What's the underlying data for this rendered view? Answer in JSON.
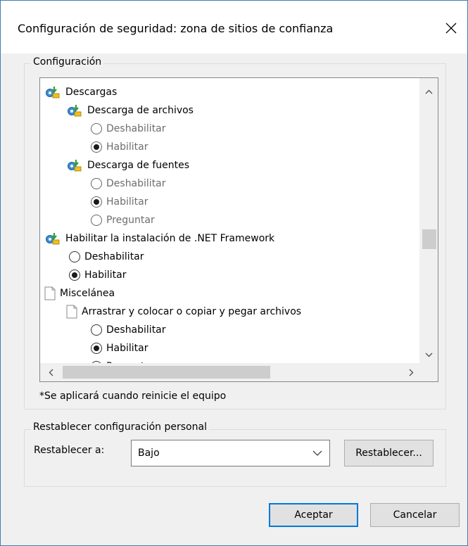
{
  "window": {
    "title": "Configuración de seguridad: zona de sitios de confianza",
    "close_glyph": "✕"
  },
  "settings_group": {
    "legend": "Configuración",
    "items": [
      {
        "kind": "gear",
        "level": 0,
        "label": "Descargas"
      },
      {
        "kind": "gear",
        "level": 1,
        "label": "Descarga de archivos"
      },
      {
        "kind": "radio",
        "level": 2,
        "label": "Deshabilitar",
        "checked": false,
        "dim": true
      },
      {
        "kind": "radio",
        "level": 2,
        "label": "Habilitar",
        "checked": true,
        "dim": true
      },
      {
        "kind": "gear",
        "level": 1,
        "label": "Descarga de fuentes"
      },
      {
        "kind": "radio",
        "level": 2,
        "label": "Deshabilitar",
        "checked": false,
        "dim": true
      },
      {
        "kind": "radio",
        "level": 2,
        "label": "Habilitar",
        "checked": true,
        "dim": true
      },
      {
        "kind": "radio",
        "level": 2,
        "label": "Preguntar",
        "checked": false,
        "dim": true
      },
      {
        "kind": "gear",
        "level": 0,
        "label": "Habilitar la instalación de .NET Framework"
      },
      {
        "kind": "radio",
        "level": 1,
        "label": "Deshabilitar",
        "checked": false,
        "dim": false
      },
      {
        "kind": "radio",
        "level": 1,
        "label": "Habilitar",
        "checked": true,
        "dim": false
      },
      {
        "kind": "page",
        "level": 0,
        "label": "Miscelánea"
      },
      {
        "kind": "page",
        "level": 1,
        "label": "Arrastrar y colocar o copiar y pegar archivos"
      },
      {
        "kind": "radio",
        "level": 2,
        "label": "Deshabilitar",
        "checked": false,
        "dim": false
      },
      {
        "kind": "radio",
        "level": 2,
        "label": "Habilitar",
        "checked": true,
        "dim": false
      },
      {
        "kind": "radio",
        "level": 2,
        "label": "Preguntar",
        "checked": false,
        "dim": false
      }
    ],
    "note": "*Se aplicará cuando reinicie el equipo"
  },
  "reset_group": {
    "legend": "Restablecer configuración personal",
    "label": "Restablecer a:",
    "selected": "Bajo",
    "reset_button": "Restablecer..."
  },
  "footer": {
    "ok_button": "Aceptar",
    "cancel_button": "Cancelar"
  },
  "colors": {
    "accent": "#0078d7",
    "window_border": "#3c7fb1",
    "dialog_bg": "#f0f0f0"
  }
}
